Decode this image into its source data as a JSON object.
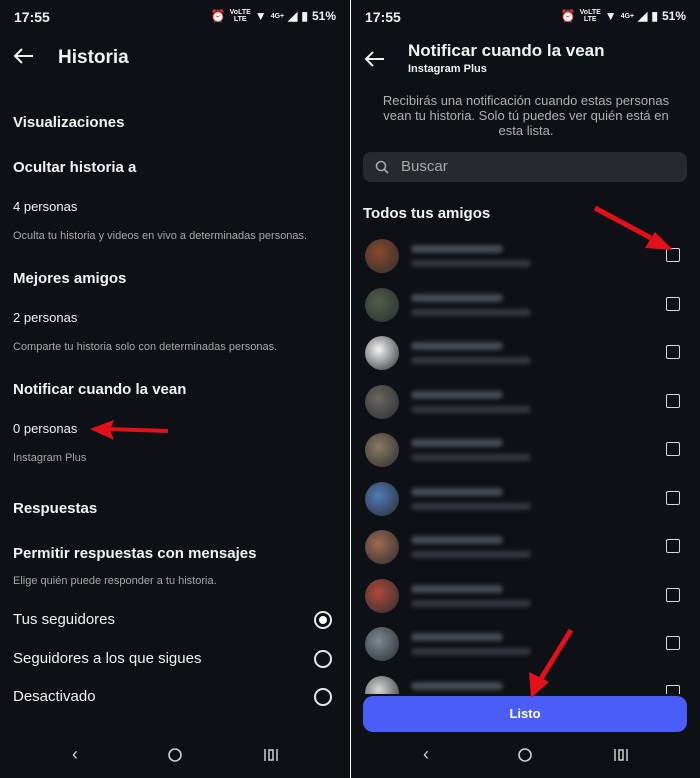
{
  "status_bar": {
    "time": "17:55",
    "net_top": "VoLTE",
    "net_bottom": "LTE",
    "signal": "4G+",
    "battery": "51%"
  },
  "left": {
    "title": "Historia",
    "views_heading": "Visualizaciones",
    "hide_story": {
      "heading": "Ocultar historia a",
      "count": "4 personas",
      "desc": "Oculta tu historia y videos en vivo a determinadas personas."
    },
    "close_friends": {
      "heading": "Mejores amigos",
      "count": "2 personas",
      "desc": "Comparte tu historia solo con determinadas personas."
    },
    "notify": {
      "heading": "Notificar cuando la vean",
      "count": "0 personas",
      "desc": "Instagram Plus"
    },
    "replies_heading": "Respuestas",
    "allow_replies": {
      "heading": "Permitir respuestas con mensajes",
      "desc": "Elige quién puede responder a tu historia."
    },
    "options": [
      {
        "label": "Tus seguidores",
        "selected": true
      },
      {
        "label": "Seguidores a los que sigues",
        "selected": false
      },
      {
        "label": "Desactivado",
        "selected": false
      }
    ]
  },
  "right": {
    "title": "Notificar cuando la vean",
    "subtitle": "Instagram Plus",
    "info": "Recibirás una notificación cuando estas personas vean tu historia. Solo tú puedes ver quién está en esta lista.",
    "search_placeholder": "Buscar",
    "list_heading": "Todos tus amigos",
    "friends_avatar_colors": [
      "#8a4a2a",
      "#4f5f48",
      "#f4f4f4",
      "#6a6660",
      "#8a7a60",
      "#4f7ab8",
      "#a06a50",
      "#b04a3a",
      "#7a8a90",
      "#d8d8d8"
    ],
    "done_label": "Listo"
  },
  "colors": {
    "background": "#0d1014",
    "accent": "#4a5df9",
    "arrow": "#e3101a"
  }
}
